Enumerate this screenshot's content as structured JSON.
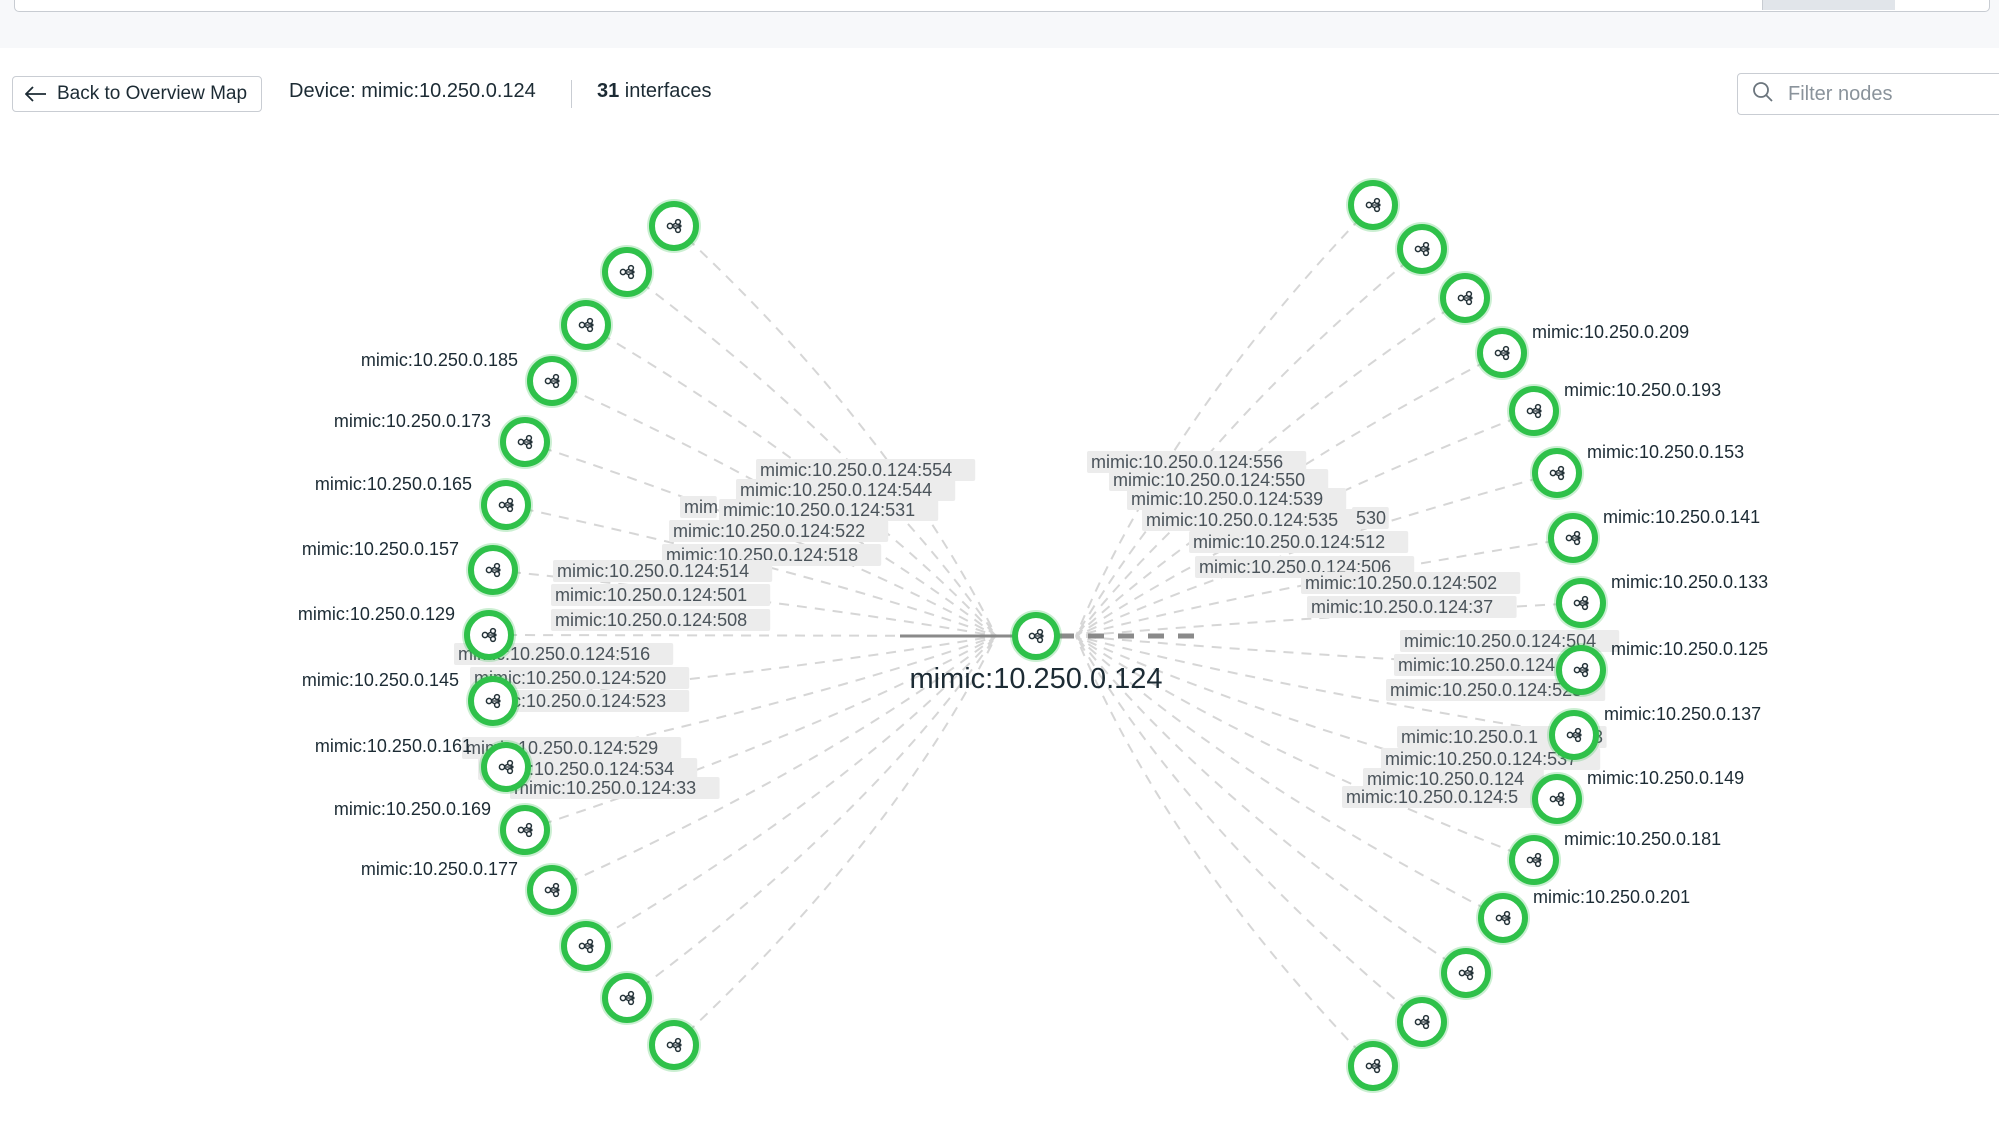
{
  "header": {
    "back_label": "Back to Overview Map",
    "device_title": "Device: mimic:10.250.0.124",
    "interface_count": "31",
    "interface_suffix": " interfaces",
    "filter_placeholder": "Filter nodes"
  },
  "colors": {
    "node_ring": "#2fc14a",
    "node_fill": "#ffffff",
    "edge": "#d6d6d6",
    "label_bg": "#ececec"
  },
  "icons": [
    "arrow-left-icon",
    "search-icon",
    "network-node-icon"
  ],
  "center_node": {
    "label": "mimic:10.250.0.124"
  },
  "left_nodes": [
    {
      "label": ""
    },
    {
      "label": ""
    },
    {
      "label": ""
    },
    {
      "label": "mimic:10.250.0.185"
    },
    {
      "label": "mimic:10.250.0.173"
    },
    {
      "label": "mimic:10.250.0.165"
    },
    {
      "label": "mimic:10.250.0.157"
    },
    {
      "label": "mimic:10.250.0.129"
    },
    {
      "label": "mimic:10.250.0.145"
    },
    {
      "label": "mimic:10.250.0.161"
    },
    {
      "label": "mimic:10.250.0.169"
    },
    {
      "label": "mimic:10.250.0.177"
    },
    {
      "label": ""
    },
    {
      "label": ""
    },
    {
      "label": ""
    }
  ],
  "right_nodes": [
    {
      "label": ""
    },
    {
      "label": ""
    },
    {
      "label": ""
    },
    {
      "label": "mimic:10.250.0.209"
    },
    {
      "label": "mimic:10.250.0.193"
    },
    {
      "label": "mimic:10.250.0.153"
    },
    {
      "label": "mimic:10.250.0.141"
    },
    {
      "label": "mimic:10.250.0.133"
    },
    {
      "label": "mimic:10.250.0.125"
    },
    {
      "label": "mimic:10.250.0.137"
    },
    {
      "label": "mimic:10.250.0.149"
    },
    {
      "label": "mimic:10.250.0.181"
    },
    {
      "label": "mimic:10.250.0.201"
    },
    {
      "label": ""
    },
    {
      "label": ""
    },
    {
      "label": ""
    }
  ],
  "left_edge_labels": [
    "mimic:10.250.0.124:554",
    "mimic:10.250.0.124:544",
    "mim",
    "mimic:10.250.0.124:531",
    "mimic:10.250.0.124:522",
    "mimic:10.250.0.124:518",
    "mimic:10.250.0.124:514",
    "mimic:10.250.0.124:501",
    "mimic:10.250.0.124:508",
    "mimic:10.250.0.124:516",
    "mimic:10.250.0.124:520",
    "mimic:10.250.0.124:523",
    "mimic:10.250.0.124:529",
    "mimic:10.250.0.124:534",
    "mimic:10.250.0.124:33"
  ],
  "right_edge_labels": [
    "mimic:10.250.0.124:556",
    "mimic:10.250.0.124:550",
    "mimic:10.250.0.124:539",
    "mimic:10.250.0.124:535",
    "530",
    "mimic:10.250.0.124:512",
    "mimic:10.250.0.124:506",
    "mimic:10.250.0.124:502",
    "mimic:10.250.0.124:37",
    "mimic:10.250.0.124:504",
    "mimic:10.250.0.124",
    "mimic:10.250.0.124:525",
    "mimic:10.250.0.1",
    "3",
    "mimic:10.250.0.124:537",
    "mimic:10.250.0.124",
    "mimic:10.250.0.124:5"
  ]
}
